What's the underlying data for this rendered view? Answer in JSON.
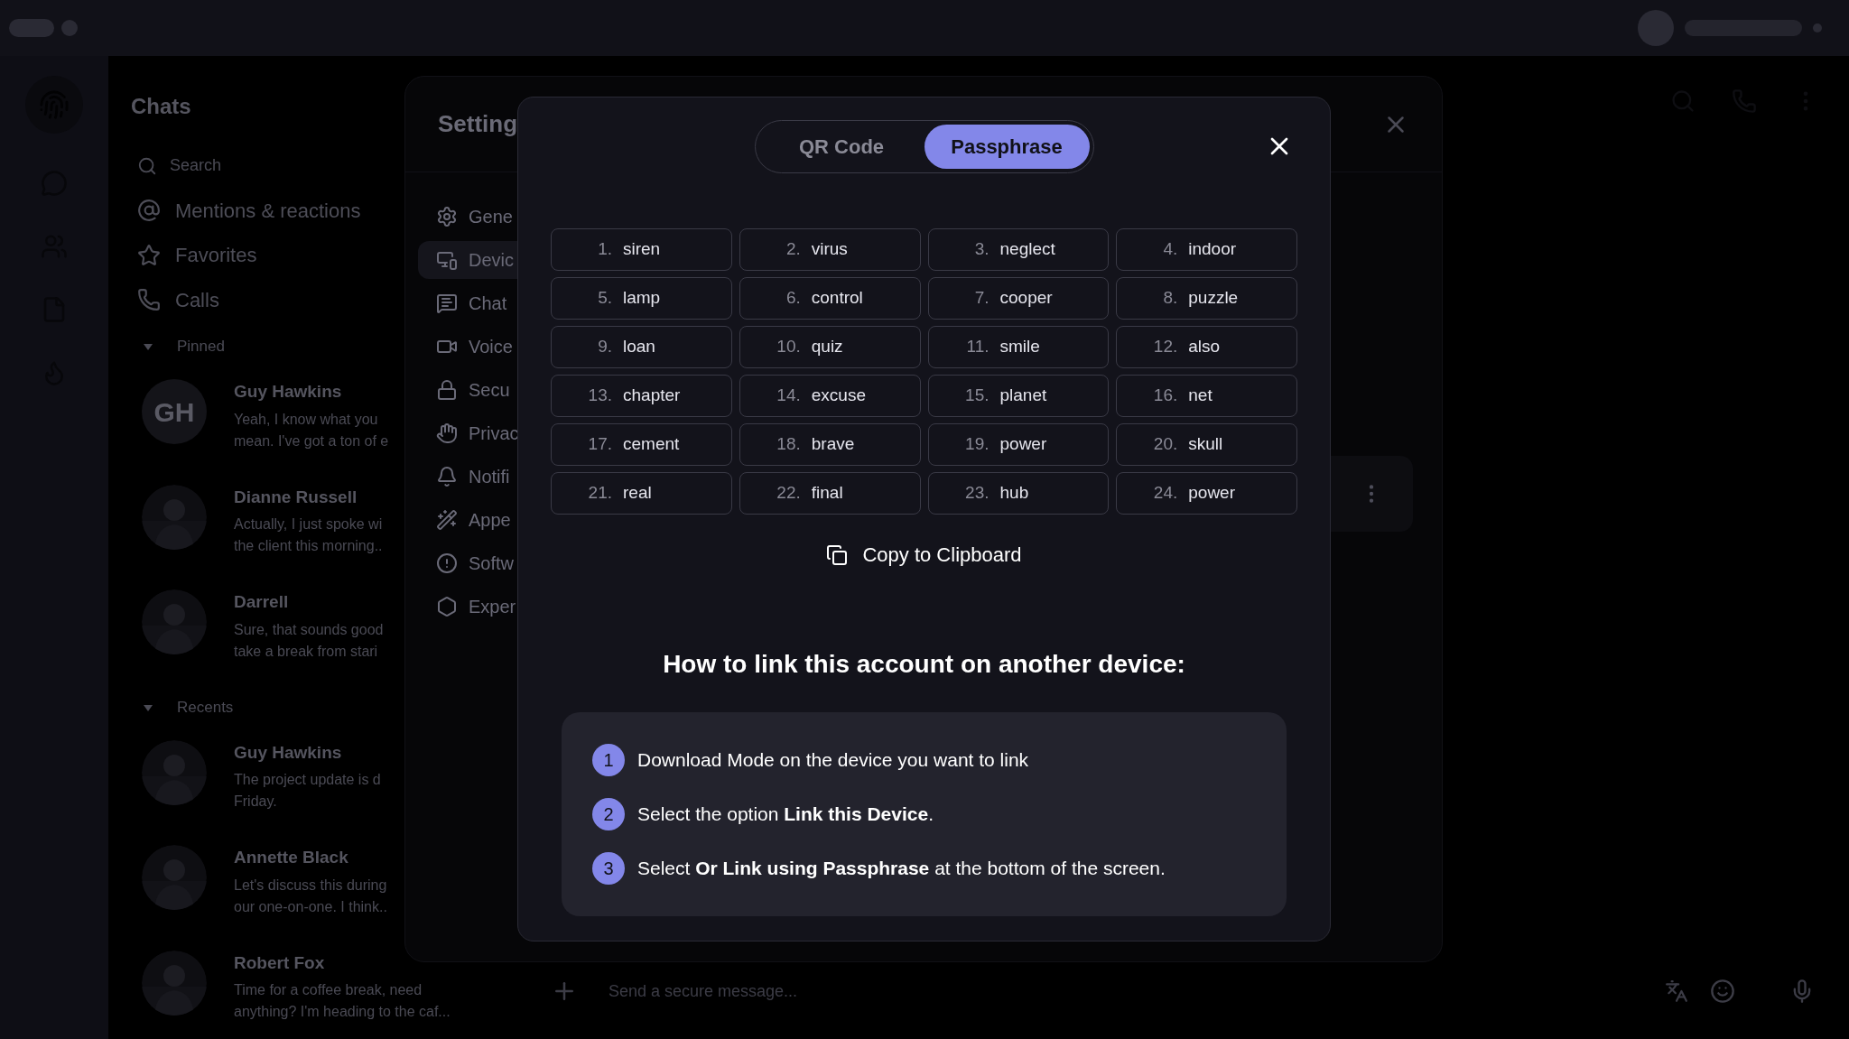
{
  "chats": {
    "title": "Chats",
    "search_placeholder": "Search",
    "nav": [
      {
        "label": "Mentions & reactions"
      },
      {
        "label": "Favorites"
      },
      {
        "label": "Calls"
      }
    ],
    "sections": [
      {
        "title": "Pinned",
        "expanded": true,
        "items": [
          {
            "name": "Guy Hawkins",
            "initials": "GH",
            "preview": [
              "Yeah, I know what you",
              "mean. I've got a ton of e"
            ]
          },
          {
            "name": "Dianne Russell",
            "preview": [
              "Actually, I just spoke wi",
              "the client this morning.."
            ]
          },
          {
            "name": "Darrell",
            "preview": [
              "Sure, that sounds good",
              "take a break from stari"
            ]
          }
        ]
      },
      {
        "title": "Recents",
        "expanded": true,
        "items": [
          {
            "name": "Guy Hawkins",
            "preview": [
              "The project update is d",
              "Friday."
            ]
          },
          {
            "name": "Annette Black",
            "preview": [
              "Let's discuss this during",
              "our one-on-one. I think.."
            ]
          },
          {
            "name": "Robert Fox",
            "preview": [
              "Time for a coffee break, need",
              "anything? I'm heading to the caf..."
            ]
          }
        ]
      }
    ]
  },
  "settings": {
    "title": "Setting",
    "menu": [
      {
        "label": "Gene",
        "selected": false
      },
      {
        "label": "Devic",
        "selected": true
      },
      {
        "label": "Chat",
        "selected": false
      },
      {
        "label": "Voice",
        "selected": false
      },
      {
        "label": "Secu",
        "selected": false
      },
      {
        "label": "Privac",
        "selected": false
      },
      {
        "label": "Notifi",
        "selected": false
      },
      {
        "label": "Appe",
        "selected": false
      },
      {
        "label": "Softw",
        "selected": false
      },
      {
        "label": "Exper",
        "selected": false
      }
    ]
  },
  "composer": {
    "placeholder": "Send a secure message..."
  },
  "dialog": {
    "tabs": [
      {
        "label": "QR Code",
        "selected": false
      },
      {
        "label": "Passphrase",
        "selected": true
      }
    ],
    "words": [
      {
        "number": "1.",
        "word": "siren"
      },
      {
        "number": "2.",
        "word": "virus"
      },
      {
        "number": "3.",
        "word": "neglect"
      },
      {
        "number": "4.",
        "word": "indoor"
      },
      {
        "number": "5.",
        "word": "lamp"
      },
      {
        "number": "6.",
        "word": "control"
      },
      {
        "number": "7.",
        "word": "cooper"
      },
      {
        "number": "8.",
        "word": "puzzle"
      },
      {
        "number": "9.",
        "word": "loan"
      },
      {
        "number": "10.",
        "word": "quiz"
      },
      {
        "number": "11.",
        "word": "smile"
      },
      {
        "number": "12.",
        "word": "also"
      },
      {
        "number": "13.",
        "word": "chapter"
      },
      {
        "number": "14.",
        "word": "excuse"
      },
      {
        "number": "15.",
        "word": "planet"
      },
      {
        "number": "16.",
        "word": "net"
      },
      {
        "number": "17.",
        "word": "cement"
      },
      {
        "number": "18.",
        "word": "brave"
      },
      {
        "number": "19.",
        "word": "power"
      },
      {
        "number": "20.",
        "word": "skull"
      },
      {
        "number": "21.",
        "word": "real"
      },
      {
        "number": "22.",
        "word": "final"
      },
      {
        "number": "23.",
        "word": "hub"
      },
      {
        "number": "24.",
        "word": "power"
      }
    ],
    "copy_button": "Copy to Clipboard",
    "heading": "How to link this account on another device:",
    "steps": [
      {
        "number": "1",
        "text": "Download Mode on the device you want to link"
      },
      {
        "number": "2",
        "text": "Select the option **Link this Device**."
      },
      {
        "number": "3",
        "text": "Select **Or Link using Passphrase** at the bottom of the screen."
      }
    ]
  }
}
